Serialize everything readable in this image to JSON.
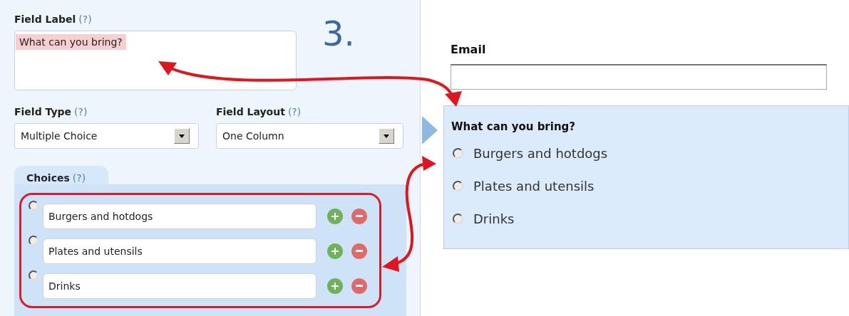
{
  "field_label": {
    "label": "Field Label",
    "help": "(?)",
    "value": "What can you bring?"
  },
  "step": "3.",
  "field_type": {
    "label": "Field Type",
    "help": "(?)",
    "value": "Multiple Choice"
  },
  "field_layout": {
    "label": "Field Layout",
    "help": "(?)",
    "value": "One Column"
  },
  "choices": {
    "label": "Choices",
    "help": "(?)",
    "items": [
      {
        "value": "Burgers and hotdogs",
        "selected": false
      },
      {
        "value": "Plates and utensils",
        "selected": false
      },
      {
        "value": "Drinks",
        "selected": false
      }
    ]
  },
  "preview": {
    "email": {
      "label": "Email"
    },
    "question": {
      "title": "What can you bring?",
      "options": [
        {
          "label": "Burgers and hotdogs",
          "selected": false
        },
        {
          "label": "Plates and utensils",
          "selected": false
        },
        {
          "label": "Drinks",
          "selected": false
        }
      ]
    }
  }
}
